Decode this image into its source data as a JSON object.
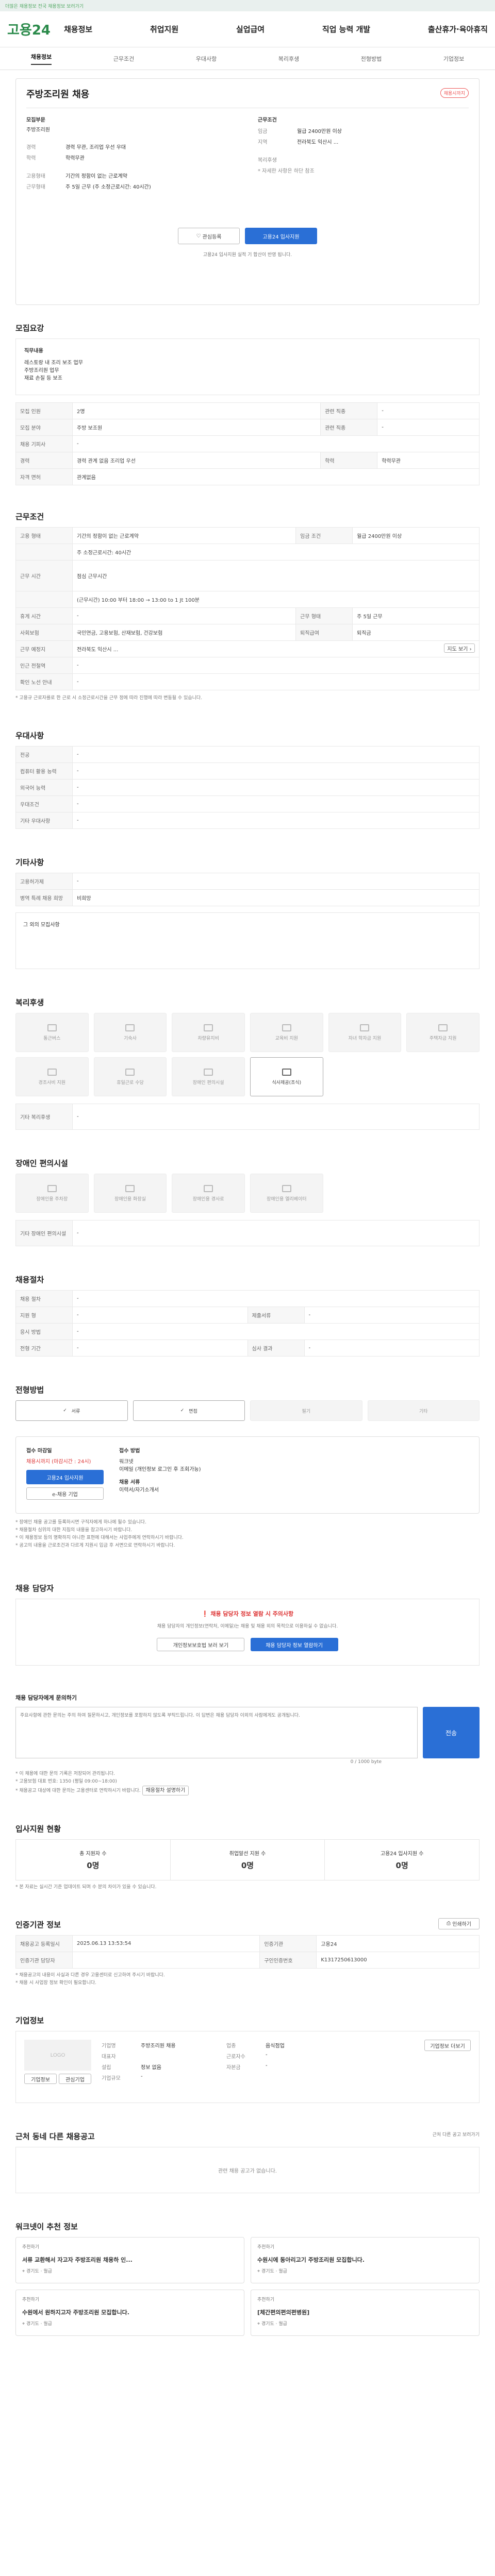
{
  "topbar": {
    "text": "더많은 채용정보 전국 채용정보 보러가기"
  },
  "gnb": {
    "logo": "고용24",
    "menu": [
      "채용정보",
      "취업지원",
      "실업급여",
      "직업 능력 개발",
      "출산휴가·육아휴직"
    ]
  },
  "tabs": [
    "채용정보",
    "근무조건",
    "우대사항",
    "복리후생",
    "전형방법",
    "기업정보"
  ],
  "job": {
    "title": "주방조리원 채용",
    "badge": "채용시까지",
    "left_label": "모집부문",
    "left_value": "주방조리원",
    "rows_left": [
      [
        "경력",
        "경력 무관, 조리업 우선 우대"
      ],
      [
        "학력",
        "학력무관"
      ],
      [
        "고용형태",
        "기간의 정함이 없는 근로계약"
      ],
      [
        "근무형태",
        "주 5일 근무 (주 소정근로시간: 40시간)"
      ]
    ],
    "right_label": "근무조건",
    "rows_right": [
      [
        "임금",
        "월급 2400만원 이상"
      ],
      [
        "지역",
        "전라북도 익산시 ..."
      ],
      [
        "복리후생",
        ""
      ]
    ],
    "note": "* 자세한 사항은 하단 참조",
    "btn_save": "관심등록",
    "btn_apply": "고용24 입사지원",
    "sub": "고용24 입사지원 실적 기 합산이 반영 됩니다."
  },
  "recruit": {
    "title": "모집요강",
    "headline": "직무내용",
    "desc": [
      "레스토랑 내 조리 보조 업무",
      "주방조리원 업무",
      "재료 손질 등 보조"
    ],
    "rows": [
      [
        "모집 인원",
        "2명",
        "관련 직종",
        "-"
      ],
      [
        "모집 분야",
        "주방 보조원",
        "관련 직종",
        "-"
      ],
      [
        "채용 기피사",
        "-",
        "",
        ""
      ],
      [
        "경력",
        "경력 관계 없음 조리업 우선",
        "학력",
        "학력무관"
      ],
      [
        "자격 면허",
        "관계없음",
        "",
        ""
      ]
    ]
  },
  "work": {
    "title": "근무조건",
    "rows": [
      [
        "고용 형태",
        "기간의 정함이 없는 근로계약",
        "임금 조건",
        "월급 2400만원 이상"
      ],
      [
        "",
        "주 소정근로시간: 40시간",
        "",
        ""
      ],
      [
        "근무 시간",
        "점심 근무시간",
        "",
        ""
      ],
      [
        "",
        "(근무시간) 10:00 부터 18:00 → 13:00 to 1 Jt 100분",
        "",
        ""
      ],
      [
        "휴게 시간",
        "-",
        "근무 형태",
        "주 5일 근무"
      ],
      [
        "사회보험",
        "국민연금, 고용보험, 산재보험, 건강보험",
        "퇴직급여",
        "퇴직금"
      ],
      [
        "근무 예정지",
        "전라북도 익산시 ...",
        "",
        ""
      ],
      [
        "인근 전철역",
        "-",
        "",
        ""
      ],
      [
        "확인 노선 안내",
        "-",
        "",
        ""
      ]
    ],
    "footnote": "* 고용규 근로자를로 한 근로 시 소정근로시간을 근무 정에 따라 진행에 따라 변동될 수 있습니다."
  },
  "prefer": {
    "title": "우대사항",
    "rows": [
      [
        "전공",
        "-"
      ],
      [
        "컴퓨터 활용 능력",
        "-"
      ],
      [
        "외국어 능력",
        "-"
      ],
      [
        "우대조건",
        "-"
      ],
      [
        "기타 우대사항",
        "-"
      ]
    ]
  },
  "other": {
    "title": "기타사항",
    "rows": [
      [
        "고용허가제",
        "-"
      ],
      [
        "병역 특례 채용 희망",
        "비희망"
      ],
      [
        "기타 문의사항",
        "-"
      ]
    ],
    "extra": "그 외의 모집사항"
  },
  "welfare": {
    "title": "복리후생",
    "items": [
      "통근버스",
      "기숙사",
      "차량유지비",
      "교육비 지원",
      "자녀 학자금 지원",
      "주택자금 지원",
      "경조사비 지원",
      "휴일근로 수당",
      "장애인 편의시설",
      "식사제공(조식)"
    ],
    "etc_label": "기타 복리후생",
    "etc_value": "-"
  },
  "disabled": {
    "title": "장애인 편의시설",
    "items": [
      "장애인용 주차장",
      "장애인용 화장실",
      "장애인용 경사로",
      "장애인용 엘리베이터"
    ],
    "etc_label": "기타 장애인 편의시설",
    "etc_value": "-"
  },
  "process": {
    "title": "채용절차",
    "rows": [
      [
        "채용 절차",
        "-",
        "",
        ""
      ],
      [
        "지원 형",
        "-",
        "제출서류",
        "-"
      ],
      [
        "응시 방법",
        "-",
        "",
        ""
      ],
      [
        "전형 기간",
        "-",
        "심사 결과",
        "-"
      ]
    ]
  },
  "steps": {
    "title": "전형방법",
    "items": [
      "서류",
      "면접",
      "필기",
      "기타"
    ]
  },
  "apply": {
    "title": "접수 마감일",
    "deadline": "채용시까지 (마감시간 : 24시)",
    "method_label": "접수 방법",
    "methods": [
      "워크넷 ",
      "이메일 (개인정보 로그인 후 조회가능)",
      "채용 서류",
      "이력서/자기소개서"
    ],
    "btn_apply": "고용24 입사지원",
    "btn_method": "e-채용 기업",
    "notes": [
      "* 장애인 채용 공고를 등록하시면 구직자에게 하나에 될수 있습니다.",
      "* 채용절차 심위의 대한 지침의 내용을 참고하시기 바랍니다.",
      "* 이 채용정보 등의 명확하지 아니한 표현에 대해서는 사업주에게 연락하시기 바랍니다.",
      "* 공고의 내용을 근로조건과 다르게 지원시 입금 후 서면으로 연락하시기 바랍니다."
    ]
  },
  "contact": {
    "title": "채용 담당자",
    "warning": "채용 담당자 정보 열람 시 주의사항",
    "warn_text": "채용 담당자의 개인정보(연락처, 이메일)는 채용 및 채용 외의 목적으로 이용하실 수 없습니다.",
    "btn_left": "개인정보보호법 보러 보기",
    "btn_right": "채용 담당자 정보 열람하기"
  },
  "inquiry": {
    "title": "채용 담당자에게 문의하기",
    "placeholder": "주요사항에 관한 문의는 주의 하여 질문하시고, 개인정보를 포함하지 않도록 부탁드립니다. 이 답변은 채용 담당자 이외의 사람에게도 공개됩니다.",
    "count": "0 / 1000 byte",
    "btn": "전송",
    "notes": [
      "* 이 채용에 대한 문의 기록은 저장되어 관리됩니다.",
      "* 고용보험 대표 번호: 1350 (평일 09:00~18:00)",
      "* 채용공고 대상에 대한 문의는 고용센터로 연락하시기 바랍니다."
    ],
    "btn_more": "채용절차 설명하기"
  },
  "status": {
    "title": "입사지원 현황",
    "items": [
      [
        "총 지원자 수",
        "0명"
      ],
      [
        "취업알선 지원 수",
        "0명"
      ],
      [
        "고용24 입사지원 수",
        "0명"
      ]
    ],
    "note": "* 본 자료는 실시간 기준 업데이트 되며 수 분의 차이가 있을 수 있습니다."
  },
  "meta": {
    "title": "인증기관 정보",
    "btn": "인쇄하기",
    "rows": [
      [
        "채용공고 등록일시",
        "2025.06.13 13:53:54",
        "인증기관",
        "고용24"
      ],
      [
        "인증기관 담당자",
        "",
        "구인인증번호",
        "K1317250613000"
      ]
    ],
    "notes": [
      "* 채용공고의 내용이 사실과 다른 경우 고용센터로 신고하여 주시기 바랍니다.",
      "* 채용 시 사업장 정보 확인이 필요합니다."
    ]
  },
  "company": {
    "title": "기업정보",
    "logo": "LOGO",
    "btn_info": "기업정보",
    "btn_fav": "관심기업",
    "rows": [
      [
        "기업명",
        "주방조리원 채용",
        "업종",
        "음식점업"
      ],
      [
        "대표자",
        "",
        "근로자수",
        "-"
      ],
      [
        "설립",
        "정보 없음",
        "자본금",
        "-"
      ],
      [
        "기업규모",
        "-",
        "",
        ""
      ]
    ],
    "btn_detail": "기업정보 더보기"
  },
  "related": {
    "title": "근처 동네 다른 채용공고",
    "empty": "관련 채용 공고가 없습니다.",
    "link": "근처 다른 공고 보러가기"
  },
  "recommend": {
    "title": "워크넷이 추천 정보",
    "cards": [
      {
        "tag": "추천하기",
        "title": "서류 교환해서 자고자 주방조리원 채용하 인...",
        "loc": "경기도",
        "pay": "월급"
      },
      {
        "tag": "추천하기",
        "title": "수원시에 동아리고기 주방조리원 모집합니다.",
        "loc": "경기도",
        "pay": "월급"
      },
      {
        "tag": "추천하기",
        "title": "수원에서 원하지고자 주방조리원 모집합니다.",
        "loc": "경기도",
        "pay": "월급"
      },
      {
        "tag": "추천하기",
        "title": "[체간편의편의편병원]",
        "loc": "경기도",
        "pay": "월급"
      }
    ]
  }
}
